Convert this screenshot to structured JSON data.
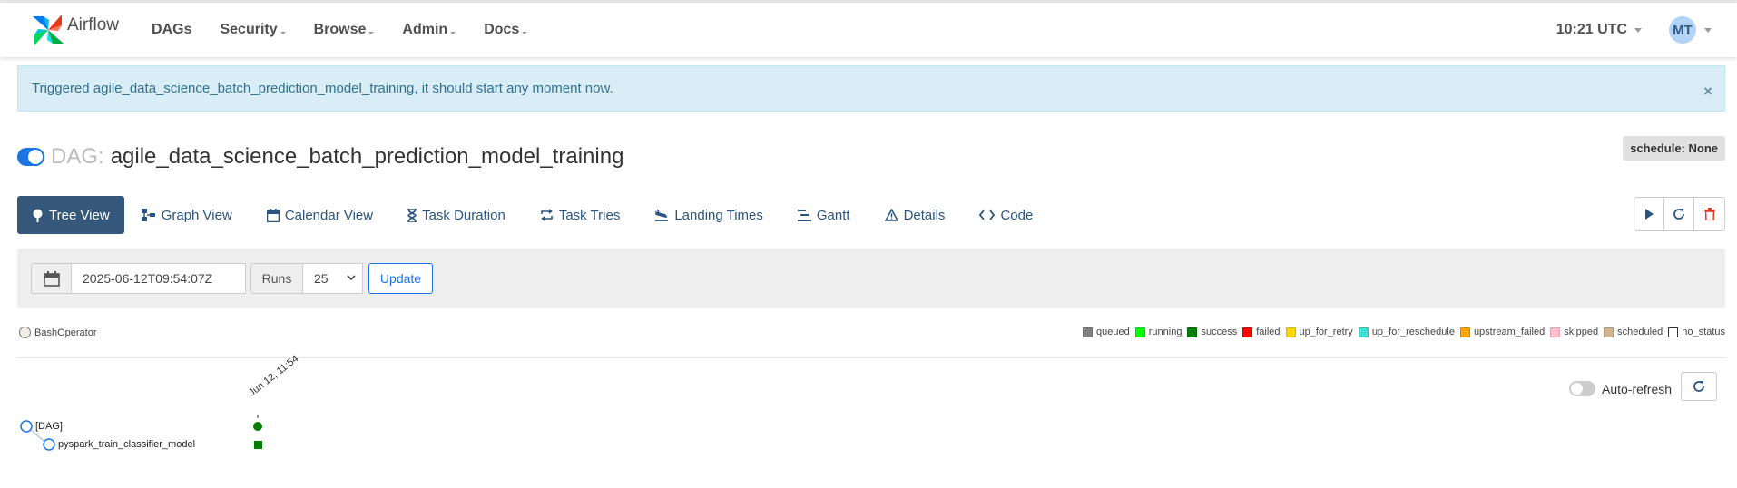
{
  "nav": {
    "brand": "Airflow",
    "items": [
      "DAGs",
      "Security",
      "Browse",
      "Admin",
      "Docs"
    ],
    "clock": "10:21 UTC",
    "user_initials": "MT"
  },
  "alert": {
    "message": "Triggered agile_data_science_batch_prediction_model_training, it should start any moment now.",
    "close": "×"
  },
  "dag": {
    "label": "DAG:",
    "id": "agile_data_science_batch_prediction_model_training",
    "schedule": "schedule: None",
    "paused": false
  },
  "tabs": [
    {
      "label": "Tree View",
      "icon": "tree-icon",
      "active": true
    },
    {
      "label": "Graph View",
      "icon": "graph-icon"
    },
    {
      "label": "Calendar View",
      "icon": "calendar-icon"
    },
    {
      "label": "Task Duration",
      "icon": "hourglass-icon"
    },
    {
      "label": "Task Tries",
      "icon": "retry-icon"
    },
    {
      "label": "Landing Times",
      "icon": "landing-icon"
    },
    {
      "label": "Gantt",
      "icon": "gantt-icon"
    },
    {
      "label": "Details",
      "icon": "warning-icon"
    },
    {
      "label": "Code",
      "icon": "code-icon"
    }
  ],
  "filters": {
    "base_date": "2025-06-12T09:54:07Z",
    "runs_label": "Runs",
    "runs_value": "25",
    "update_label": "Update"
  },
  "operator_legend": "BashOperator",
  "states": [
    {
      "label": "queued",
      "color": "#808080"
    },
    {
      "label": "running",
      "color": "#00ff00"
    },
    {
      "label": "success",
      "color": "#008000"
    },
    {
      "label": "failed",
      "color": "#ff0000"
    },
    {
      "label": "up_for_retry",
      "color": "#ffd700"
    },
    {
      "label": "up_for_reschedule",
      "color": "#40e0d0"
    },
    {
      "label": "upstream_failed",
      "color": "#ffa500"
    },
    {
      "label": "skipped",
      "color": "#ffc0cb"
    },
    {
      "label": "scheduled",
      "color": "#d2b48c"
    },
    {
      "label": "no_status",
      "color": "#ffffff"
    }
  ],
  "auto_refresh_label": "Auto-refresh",
  "tree": {
    "run_date": "Jun 12, 11:54",
    "nodes": [
      "[DAG]",
      "pyspark_train_classifier_model"
    ]
  }
}
